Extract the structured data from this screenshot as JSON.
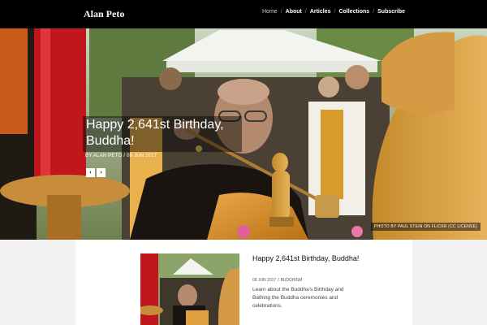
{
  "site": {
    "brand": "Alan Peto"
  },
  "nav": {
    "items": [
      {
        "label": "Home",
        "active": true
      },
      {
        "label": "About",
        "active": false
      },
      {
        "label": "Articles",
        "active": false
      },
      {
        "label": "Collections",
        "active": false
      },
      {
        "label": "Subscribe",
        "active": false
      }
    ],
    "separator": "/"
  },
  "hero": {
    "title": "Happy 2,641st Birthday, Buddha!",
    "author_prefix": "By",
    "author": "Alan Peto",
    "date": "09 Jun 2017",
    "prev_icon": "chevron-left-icon",
    "next_icon": "chevron-right-icon",
    "prev_glyph": "‹",
    "next_glyph": "›",
    "credit": "Photo by Paul Stein on Flickr (CC License)"
  },
  "post": {
    "title": "Happy 2,641st Birthday, Buddha!",
    "date": "09 Jun 2017",
    "category": "Buddhism",
    "excerpt": "Learn about the Buddha's Birthday and Bathing the Buddha ceremonies and celebrations."
  },
  "colors": {
    "header_bg": "#000000",
    "page_bg": "#f2f2f2",
    "card_bg": "#ffffff",
    "text_dark": "#111111",
    "text_muted": "#555555"
  }
}
